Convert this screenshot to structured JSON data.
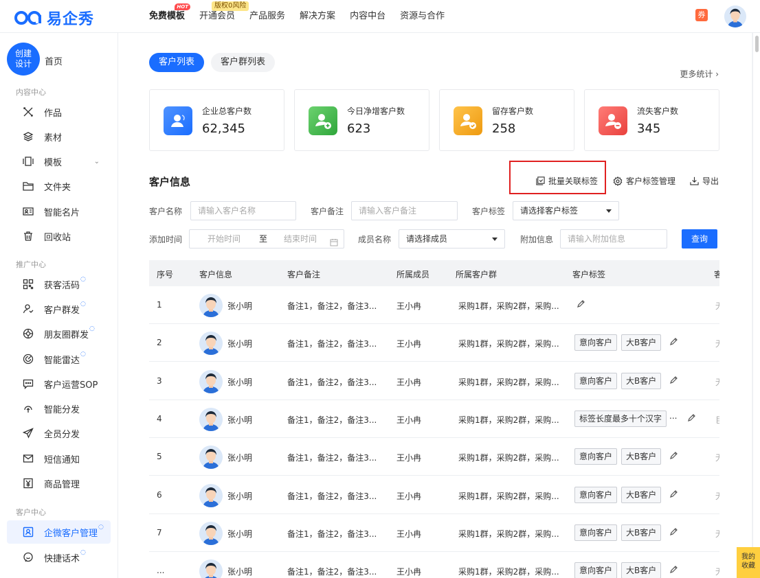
{
  "brand": {
    "name": "易企秀"
  },
  "nav": [
    {
      "label": "免费模板",
      "active": true,
      "badge": "HOT"
    },
    {
      "label": "开通会员",
      "badge": "版权0风险"
    },
    {
      "label": "产品服务"
    },
    {
      "label": "解决方案"
    },
    {
      "label": "内容中台"
    },
    {
      "label": "资源与合作"
    }
  ],
  "coupon": "券",
  "sidebar": {
    "create": [
      "创建",
      "设计"
    ],
    "home": "首页",
    "sections": [
      {
        "title": "内容中心",
        "items": [
          "作品",
          "素材",
          "模板",
          "文件夹",
          "智能名片",
          "回收站"
        ]
      },
      {
        "title": "推广中心",
        "items": [
          "获客活码",
          "客户群发",
          "朋友圈群发",
          "智能雷达",
          "客户运营SOP",
          "智能分发",
          "全员分发",
          "短信通知",
          "商品管理"
        ]
      },
      {
        "title": "客户中心",
        "items": [
          "企微客户管理",
          "快捷话术"
        ]
      }
    ]
  },
  "tabs": [
    "客户列表",
    "客户群列表"
  ],
  "more_stats": "更多统计 ›",
  "stats": [
    {
      "label": "企业总客户数",
      "value": "62,345",
      "color": "#2f7bf5"
    },
    {
      "label": "今日净增客户数",
      "value": "623",
      "color": "#3fb24a"
    },
    {
      "label": "留存客户数",
      "value": "258",
      "color": "#f0a11c"
    },
    {
      "label": "流失客户数",
      "value": "345",
      "color": "#f0524f"
    }
  ],
  "section_title": "客户信息",
  "actions": {
    "batch_tag": "批量关联标签",
    "tag_manage": "客户标签管理",
    "export": "导出"
  },
  "filters": {
    "name_label": "客户名称",
    "name_placeholder": "请输入客户名称",
    "remark_label": "客户备注",
    "remark_placeholder": "请输入客户备注",
    "tag_label": "客户标签",
    "tag_value": "请选择客户标签",
    "time_label": "添加时间",
    "start_placeholder": "开始时间",
    "to": "至",
    "end_placeholder": "结束时间",
    "member_label": "成员名称",
    "member_value": "请选择成员",
    "extra_label": "附加信息",
    "extra_placeholder": "请输入附加信息",
    "query": "查询"
  },
  "table": {
    "headers": [
      "序号",
      "客户信息",
      "客户备注",
      "所属成员",
      "所属客户群",
      "客户标签",
      "客"
    ],
    "rows": [
      {
        "idx": "1",
        "name": "张小明",
        "remark": "备注1，备注2，备注3...",
        "member": "王小冉",
        "groups": "采购1群，采购2群，采购...",
        "tags": []
      },
      {
        "idx": "2",
        "name": "张小明",
        "remark": "备注1，备注2，备注3...",
        "member": "王小冉",
        "groups": "采购1群，采购2群，采购...",
        "tags": [
          "意向客户",
          "大B客户"
        ]
      },
      {
        "idx": "3",
        "name": "张小明",
        "remark": "备注1，备注2，备注3...",
        "member": "王小冉",
        "groups": "采购1群，采购2群，采购...",
        "tags": [
          "意向客户",
          "大B客户"
        ]
      },
      {
        "idx": "4",
        "name": "张小明",
        "remark": "备注1，备注2，备注3...",
        "member": "王小冉",
        "groups": "采购1群，采购2群，采购...",
        "tags": [
          "标签长度最多十个汉字"
        ],
        "more": "..."
      },
      {
        "idx": "5",
        "name": "张小明",
        "remark": "备注1，备注2，备注3...",
        "member": "王小冉",
        "groups": "采购1群，采购2群，采购...",
        "tags": [
          "意向客户",
          "大B客户"
        ]
      },
      {
        "idx": "6",
        "name": "张小明",
        "remark": "备注1，备注2，备注3...",
        "member": "王小冉",
        "groups": "采购1群，采购2群，采购...",
        "tags": [
          "意向客户",
          "大B客户"
        ]
      },
      {
        "idx": "7",
        "name": "张小明",
        "remark": "备注1，备注2，备注3...",
        "member": "王小冉",
        "groups": "采购1群，采购2群，采购...",
        "tags": [
          "意向客户",
          "大B客户"
        ]
      },
      {
        "idx": "...",
        "name": "张小明",
        "remark": "备注1，备注2，备注3...",
        "member": "王小冉",
        "groups": "采购1群，采购2群，采购...",
        "tags": [
          "意向客户",
          "大B客户"
        ]
      }
    ],
    "last_col": [
      "无",
      "无",
      "无",
      "巨",
      "无",
      "无",
      "无",
      "无"
    ]
  },
  "favorites": [
    "我的",
    "收藏"
  ]
}
